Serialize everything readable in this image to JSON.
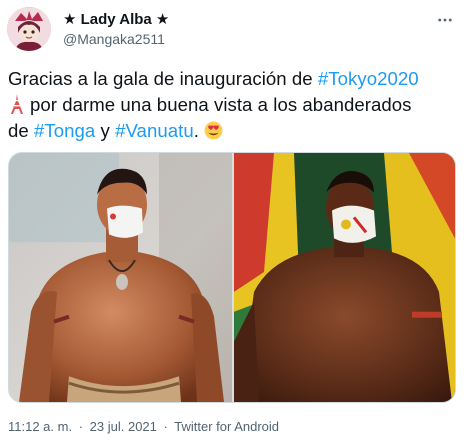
{
  "author": {
    "display_name": "★ Lady Alba ★",
    "handle": "@Mangaka2511"
  },
  "tweet": {
    "line1_prefix": "Gracias a la gala de inauguración de ",
    "hashtag_tokyo": "#Tokyo2020",
    "line2_text": "por darme una buena vista a los abanderados",
    "line3_prefix": "de ",
    "hashtag_tonga": "#Tonga",
    "line3_mid": " y ",
    "hashtag_vanuatu": "#Vanuatu",
    "line3_suffix": ". "
  },
  "footer": {
    "time": "11:12 a. m.",
    "separator1": "·",
    "date": "23 jul. 2021",
    "separator2": "·",
    "source": "Twitter for Android"
  },
  "icons": {
    "more": "more-options-icon",
    "tower": "tokyo-tower-icon",
    "emoji": "heart-eyes-emoji-icon"
  },
  "colors": {
    "link": "#1d9bf0",
    "text": "#0f1419",
    "muted": "#536471"
  }
}
